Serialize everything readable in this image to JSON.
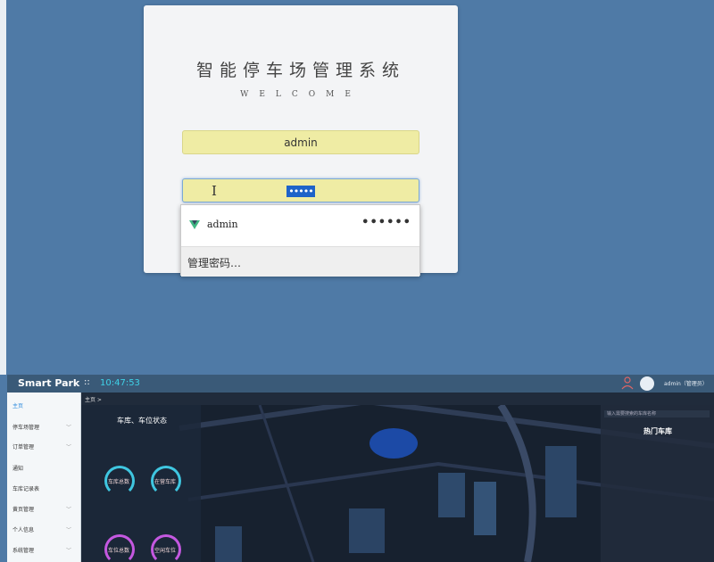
{
  "login": {
    "title": "智能停车场管理系统",
    "welcome": "WELCOME",
    "username_value": "admin",
    "password_value": "•••••"
  },
  "autofill": {
    "username": "admin",
    "password_mask": "••••••",
    "manage_label": "管理密码…",
    "icon": "vue-logo-icon"
  },
  "dashboard": {
    "brand": "Smart Park",
    "clock": "10:47:53",
    "user_label": "admin（管理员）",
    "breadcrumb": "主页 >",
    "sidebar": [
      {
        "label": "主页",
        "has_arrow": false,
        "active": true
      },
      {
        "label": "停车场管理",
        "has_arrow": true
      },
      {
        "label": "订单管理",
        "has_arrow": true
      },
      {
        "label": "通知",
        "has_arrow": false
      },
      {
        "label": "车库记录表",
        "has_arrow": false
      },
      {
        "label": "黄页管理",
        "has_arrow": true
      },
      {
        "label": "个人信息",
        "has_arrow": true
      },
      {
        "label": "系统管理",
        "has_arrow": true
      }
    ],
    "left_panel_title": "车库、车位状态",
    "gauges": [
      {
        "label": "车库总数",
        "color": "#3fc6e0"
      },
      {
        "label": "在营车库",
        "color": "#3fc6e0"
      },
      {
        "label": "车位总数",
        "color": "#c458e0"
      },
      {
        "label": "空闲车位",
        "color": "#c458e0"
      }
    ],
    "search_placeholder": "输入需要搜索的车库名称",
    "right_panel_title": "热门车库"
  }
}
